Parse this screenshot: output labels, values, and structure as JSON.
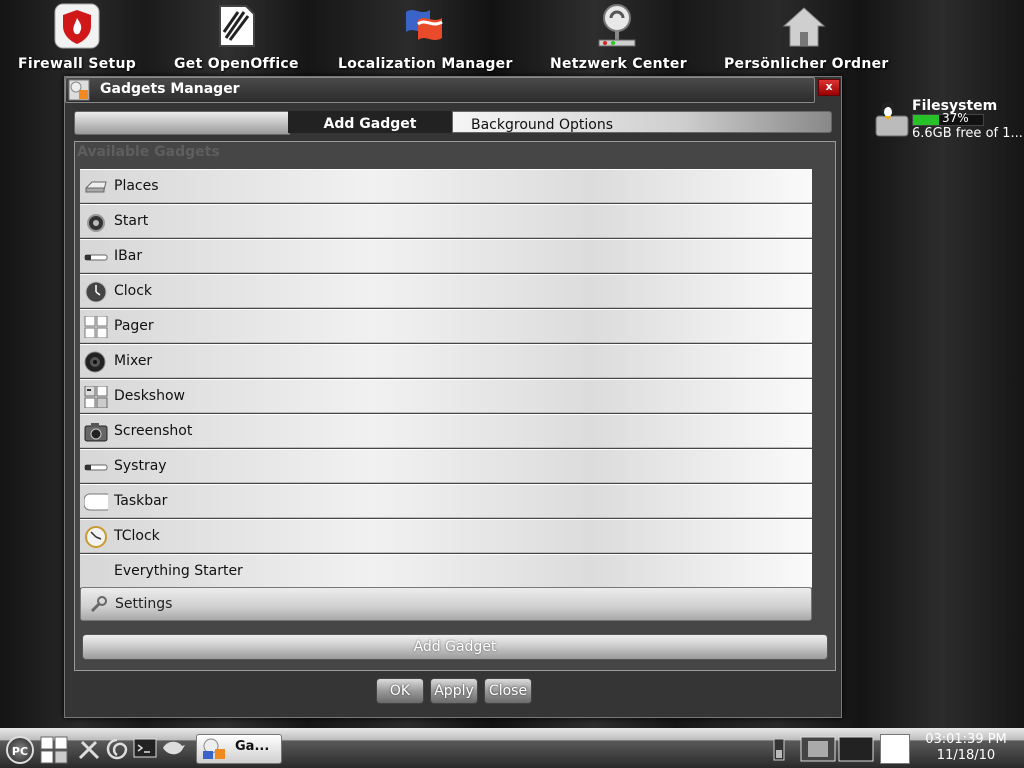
{
  "desktop": {
    "icons": [
      {
        "label": "Firewall Setup",
        "icon": "firewall-shield-icon"
      },
      {
        "label": "Get OpenOffice",
        "icon": "openoffice-icon"
      },
      {
        "label": "Localization Manager",
        "icon": "localization-flags-icon"
      },
      {
        "label": "Netzwerk Center",
        "icon": "network-icon"
      },
      {
        "label": "Persönlicher Ordner",
        "icon": "home-folder-icon"
      }
    ],
    "filesystem": {
      "title": "Filesystem",
      "percent_label": "37%",
      "percent": 37,
      "free_label": "6.6GB free of 1..."
    }
  },
  "dialog": {
    "title": "Gadgets Manager",
    "close_label": "x",
    "tabs": {
      "active": "Add Gadget",
      "other": "Background Options"
    },
    "panel_header": "Available Gadgets",
    "gadgets": [
      {
        "label": "Places",
        "icon": "drive-icon"
      },
      {
        "label": "Start",
        "icon": "start-icon"
      },
      {
        "label": "IBar",
        "icon": "bar-icon"
      },
      {
        "label": "Clock",
        "icon": "clock-icon"
      },
      {
        "label": "Pager",
        "icon": "pager-icon"
      },
      {
        "label": "Mixer",
        "icon": "speaker-icon"
      },
      {
        "label": "Deskshow",
        "icon": "deskshow-icon"
      },
      {
        "label": "Screenshot",
        "icon": "camera-icon"
      },
      {
        "label": "Systray",
        "icon": "systray-icon"
      },
      {
        "label": "Taskbar",
        "icon": "taskbar-icon"
      },
      {
        "label": "TClock",
        "icon": "tclock-icon"
      },
      {
        "label": "Everything Starter",
        "icon": ""
      }
    ],
    "settings_label": "Settings",
    "add_gadget_button": "Add Gadget",
    "buttons": {
      "ok": "OK",
      "apply": "Apply",
      "close": "Close"
    }
  },
  "taskbar": {
    "start_label": "PC",
    "task_label": "Ga...",
    "clock": {
      "time": "03:01:39 PM",
      "date": "11/18/10"
    }
  },
  "colors": {
    "fs_bar": "#27c227",
    "close_button": "#cc2222"
  }
}
